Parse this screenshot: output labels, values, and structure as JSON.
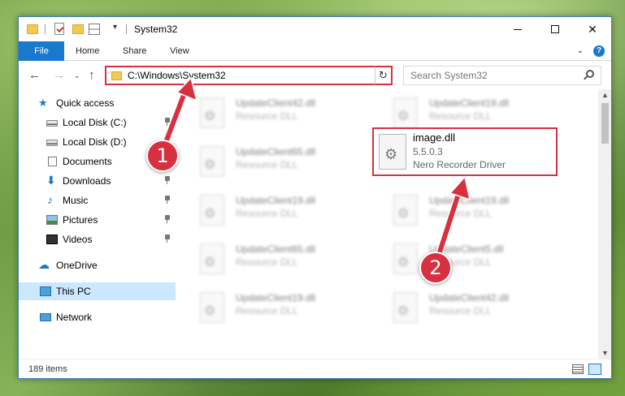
{
  "window": {
    "title": "System32",
    "min_glyph": "",
    "close_glyph": "✕"
  },
  "ribbon": {
    "file": "File",
    "home": "Home",
    "share": "Share",
    "view": "View",
    "chevron": "⌄",
    "help": "?"
  },
  "nav": {
    "back": "←",
    "forward": "→",
    "recent": "⌄",
    "up": "↑",
    "address": "C:\\Windows\\System32",
    "address_chevron": "⌄",
    "refresh": "↻",
    "search_placeholder": "Search System32"
  },
  "sidebar": {
    "items": [
      {
        "label": "Quick access"
      },
      {
        "label": "Local Disk (C:)"
      },
      {
        "label": "Local Disk (D:)"
      },
      {
        "label": "Documents"
      },
      {
        "label": "Downloads"
      },
      {
        "label": "Music"
      },
      {
        "label": "Pictures"
      },
      {
        "label": "Videos"
      },
      {
        "label": "OneDrive"
      },
      {
        "label": "This PC"
      },
      {
        "label": "Network"
      }
    ]
  },
  "files": [
    {
      "name": "UpdateClient42.dll",
      "type": "Resource DLL"
    },
    {
      "name": "UpdateClient19.dll",
      "type": "Resource DLL"
    },
    {
      "name": "UpdateClient65.dll",
      "type": "Resource DLL"
    },
    {
      "name": "UpdateClient19.dll",
      "type": "Resource DLL"
    },
    {
      "name": "UpdateClient19.dll",
      "type": "Resource DLL"
    },
    {
      "name": "UpdateClient65.dll",
      "type": "Resource DLL"
    },
    {
      "name": "UpdateClient5.dll",
      "type": "Resource DLL"
    },
    {
      "name": "UpdateClient19.dll",
      "type": "Resource DLL"
    },
    {
      "name": "UpdateClient42.dll",
      "type": "Resource DLL"
    }
  ],
  "highlighted_file": {
    "name": "image.dll",
    "version": "5.5.0.3",
    "description": "Nero Recorder Driver"
  },
  "status": {
    "count": "189 items"
  },
  "annotations": {
    "step1": "1",
    "step2": "2"
  },
  "colors": {
    "accent": "#1979ca",
    "highlight_red": "#d9303f",
    "selected_bg": "#cce8ff"
  }
}
